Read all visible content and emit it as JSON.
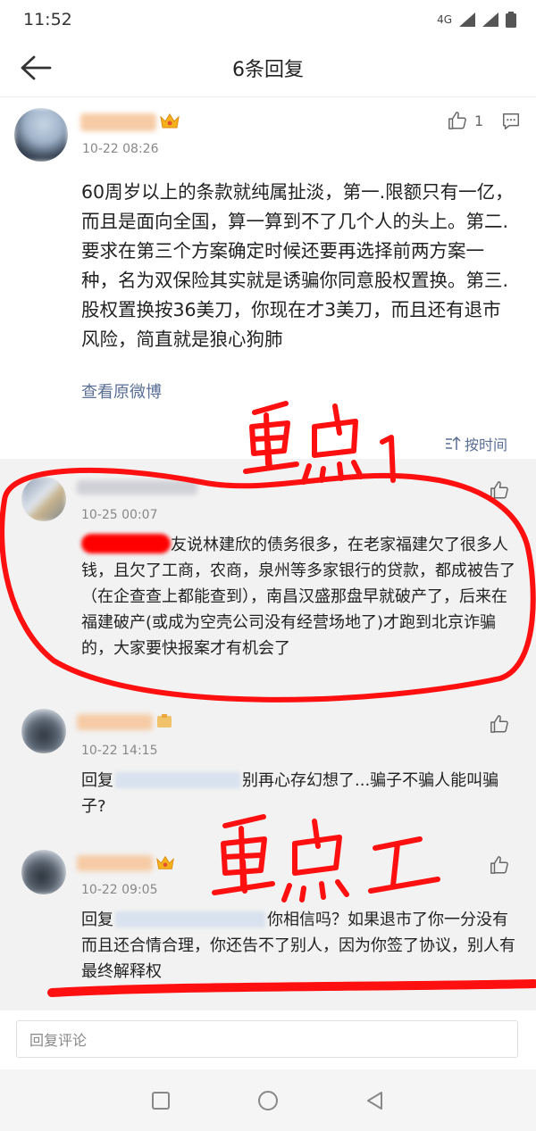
{
  "status_bar": {
    "time": "11:52",
    "network": "4G"
  },
  "header": {
    "title": "6条回复"
  },
  "main_comment": {
    "time": "10-22 08:26",
    "like_count": "1",
    "text": "60周岁以上的条款就纯属扯淡，第一.限额只有一亿，而且是面向全国，算一算到不了几个人的头上。第二.要求在第三个方案确定时候还要再选择前两方案一种，名为双保险其实就是诱骗你同意股权置换。第三.股权置换按36美刀，你现在才3美刀，而且还有退市风险，简直就是狼心狗肺",
    "view_original": "查看原微博",
    "sort_label": "按时间"
  },
  "replies": [
    {
      "time": "10-25 00:07",
      "text": "友说林建欣的债务很多，在老家福建欠了很多人钱，且欠了工商，农商，泉州等多家银行的贷款，都成被告了（在企查查上都能查到），南昌汉盛那盘早就破产了，后来在福建破产(或成为空壳公司没有经营场地了)才跑到北京诈骗的，大家要快报案才有机会了"
    },
    {
      "time": "10-22 14:15",
      "reply_prefix": "回复",
      "text": "别再心存幻想了...骗子不骗人能叫骗子?"
    },
    {
      "time": "10-22 09:05",
      "reply_prefix": "回复",
      "text": "你相信吗？如果退市了你一分没有而且还合情合理，你还告不了别人，因为你签了协议，别人有最终解释权"
    }
  ],
  "reply_input": {
    "placeholder": "回复评论"
  },
  "annotations": {
    "mark1": "重点1",
    "mark2": "重点2",
    "color": "#ff0000"
  }
}
